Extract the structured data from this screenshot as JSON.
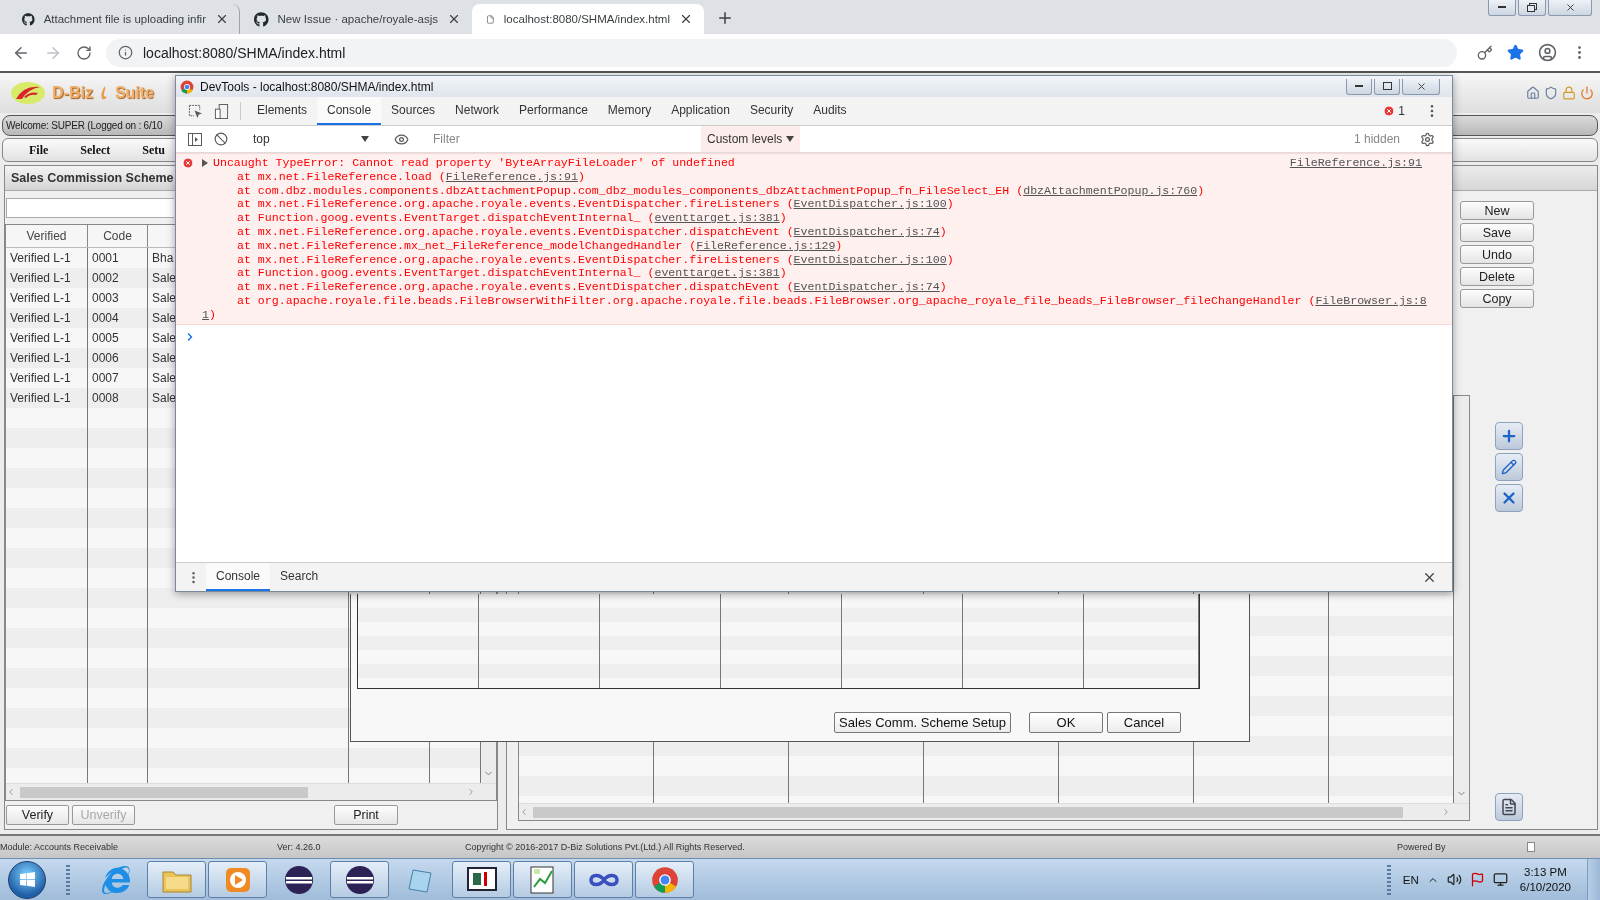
{
  "browser": {
    "tabs": [
      {
        "title": "Attachment file is uploading infir",
        "selected": false
      },
      {
        "title": "New Issue · apache/royale-asjs",
        "selected": false
      },
      {
        "title": "localhost:8080/SHMA/index.html",
        "selected": true
      }
    ],
    "url": "localhost:8080/SHMA/index.html",
    "bookmarked": true
  },
  "app": {
    "logo": {
      "left": "D-Biz",
      "right": "Suite"
    },
    "welcome": "Welcome: SUPER (Logged on : 6/10",
    "menu": [
      "File",
      "Select",
      "Setu"
    ],
    "list": {
      "title": "Sales Commission Scheme",
      "columns": [
        "Verified",
        "Code"
      ],
      "rows": [
        {
          "status": "Verified L-1",
          "code": "0001",
          "name": "Bha"
        },
        {
          "status": "Verified L-1",
          "code": "0002",
          "name": "Sale"
        },
        {
          "status": "Verified L-1",
          "code": "0003",
          "name": "Sale"
        },
        {
          "status": "Verified L-1",
          "code": "0004",
          "name": "Sale"
        },
        {
          "status": "Verified L-1",
          "code": "0005",
          "name": "Sale"
        },
        {
          "status": "Verified L-1",
          "code": "0006",
          "name": "Sale"
        },
        {
          "status": "Verified L-1",
          "code": "0007",
          "name": "Sale"
        },
        {
          "status": "Verified L-1",
          "code": "0008",
          "name": "Sale"
        }
      ],
      "buttons": [
        {
          "label": "Verify",
          "disabled": false
        },
        {
          "label": "Unverify",
          "disabled": true
        },
        {
          "label": "Print",
          "disabled": false
        }
      ]
    },
    "actions": [
      "New",
      "Save",
      "Undo",
      "Delete",
      "Copy"
    ],
    "dialog": {
      "buttons": [
        "Sales Comm. Scheme Setup",
        "OK",
        "Cancel"
      ]
    },
    "footer": {
      "module": "Module: Accounts Receivable",
      "version": "Ver: 4.26.0",
      "copyright": "Copyright © 2016-2017 D-Biz Solutions Pvt.(Ltd.) All Rights Reserved.",
      "powered": "Powered By"
    }
  },
  "devtools": {
    "title": "DevTools - localhost:8080/SHMA/index.html",
    "tabs": [
      {
        "label": "Elements",
        "selected": false
      },
      {
        "label": "Console",
        "selected": true
      },
      {
        "label": "Sources",
        "selected": false
      },
      {
        "label": "Network",
        "selected": false
      },
      {
        "label": "Performance",
        "selected": false
      },
      {
        "label": "Memory",
        "selected": false
      },
      {
        "label": "Application",
        "selected": false
      },
      {
        "label": "Security",
        "selected": false
      },
      {
        "label": "Audits",
        "selected": false
      }
    ],
    "error_count": "1",
    "context": "top",
    "filter": {
      "placeholder": "Filter"
    },
    "levels": "Custom levels",
    "hidden": "1 hidden",
    "error": {
      "message": "Uncaught TypeError: Cannot read property 'ByteArrayFileLoader' of undefined",
      "source": "FileReference.js:91",
      "stack": [
        {
          "text": "at mx.net.FileReference.load (",
          "link": "FileReference.js:91",
          "end": ")"
        },
        {
          "text": "at com.dbz.modules.components.dbzAttachmentPopup.com_dbz_modules_components_dbzAttachmentPopup_fn_FileSelect_EH (",
          "link": "dbzAttachmentPopup.js:760",
          "end": ")"
        },
        {
          "text": "at mx.net.FileReference.org.apache.royale.events.EventDispatcher.fireListeners (",
          "link": "EventDispatcher.js:100",
          "end": ")"
        },
        {
          "text": "at Function.goog.events.EventTarget.dispatchEventInternal_ (",
          "link": "eventtarget.js:381",
          "end": ")"
        },
        {
          "text": "at mx.net.FileReference.org.apache.royale.events.EventDispatcher.dispatchEvent (",
          "link": "EventDispatcher.js:74",
          "end": ")"
        },
        {
          "text": "at mx.net.FileReference.mx_net_FileReference_modelChangedHandler (",
          "link": "FileReference.js:129",
          "end": ")"
        },
        {
          "text": "at mx.net.FileReference.org.apache.royale.events.EventDispatcher.fireListeners (",
          "link": "EventDispatcher.js:100",
          "end": ")"
        },
        {
          "text": "at Function.goog.events.EventTarget.dispatchEventInternal_ (",
          "link": "eventtarget.js:381",
          "end": ")"
        },
        {
          "text": "at mx.net.FileReference.org.apache.royale.events.EventDispatcher.dispatchEvent (",
          "link": "EventDispatcher.js:74",
          "end": ")"
        },
        {
          "text": "at org.apache.royale.file.beads.FileBrowserWithFilter.org.apache.royale.file.beads.FileBrowser.org_apache_royale_file_beads_FileBrowser_fileChangeHandler (",
          "link": "FileBrowser.js:8"
        }
      ],
      "wrap": {
        "link": "1",
        "end": ")"
      }
    },
    "drawer": [
      {
        "label": "Console",
        "selected": true
      },
      {
        "label": "Search",
        "selected": false
      }
    ]
  },
  "taskbar": {
    "apps": [
      {
        "kind": "ie",
        "running": false
      },
      {
        "kind": "folder",
        "running": true
      },
      {
        "kind": "media",
        "running": true
      },
      {
        "kind": "eclipse",
        "running": false
      },
      {
        "kind": "eclipse",
        "running": true
      },
      {
        "kind": "notepad",
        "running": false
      },
      {
        "kind": "slides",
        "running": true
      },
      {
        "kind": "chart",
        "running": true
      },
      {
        "kind": "infinity",
        "running": true
      },
      {
        "kind": "chrome",
        "running": true
      }
    ],
    "language": "EN",
    "time": "3:13 PM",
    "date": "6/10/2020"
  }
}
